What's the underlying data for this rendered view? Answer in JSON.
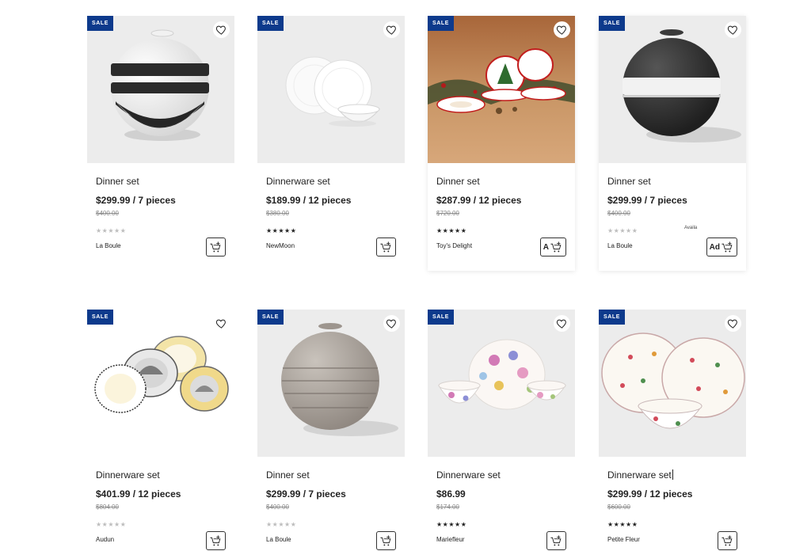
{
  "badges": {
    "sale": "SALE"
  },
  "cart_overlay": {
    "label_short": "A",
    "label_add": "Ad",
    "availability": "Availa"
  },
  "products": [
    {
      "title": "Dinner set",
      "price": "$299.99 / 7 pieces",
      "old_price": "$400.00",
      "stars": "★★★★★",
      "rating_filled": false,
      "brand": "La Boule"
    },
    {
      "title": "Dinnerware set",
      "price": "$189.99 / 12 pieces",
      "old_price": "$380.00",
      "stars": "★★★★★",
      "rating_filled": true,
      "brand": "NewMoon"
    },
    {
      "title": "Dinner set",
      "price": "$287.99 / 12 pieces",
      "old_price": "$720.00",
      "stars": "★★★★★",
      "rating_filled": true,
      "brand": "Toy's Delight"
    },
    {
      "title": "Dinner set",
      "price": "$299.99 / 7 pieces",
      "old_price": "$400.00",
      "stars": "★★★★★",
      "rating_filled": false,
      "brand": "La Boule"
    },
    {
      "title": "Dinnerware set",
      "price": "$401.99 / 12 pieces",
      "old_price": "$804.00",
      "stars": "★★★★★",
      "rating_filled": false,
      "brand": "Audun"
    },
    {
      "title": "Dinner set",
      "price": "$299.99 / 7 pieces",
      "old_price": "$400.00",
      "stars": "★★★★★",
      "rating_filled": false,
      "brand": "La Boule"
    },
    {
      "title": "Dinnerware set",
      "price": "$86.99",
      "old_price": "$174.00",
      "stars": "★★★★★",
      "rating_filled": true,
      "brand": "Mariefleur"
    },
    {
      "title": "Dinnerware set",
      "price": "$299.99 / 12 pieces",
      "old_price": "$600.00",
      "stars": "★★★★★",
      "rating_filled": true,
      "brand": "Petite Fleur"
    }
  ],
  "icons": {
    "wishlist": "heart-outline-icon",
    "cart": "add-to-cart-icon"
  },
  "colors": {
    "sale_badge": "#0d3a8c",
    "image_bg": "#ececec",
    "star_empty": "#bdbdbd",
    "star_filled": "#222222"
  }
}
